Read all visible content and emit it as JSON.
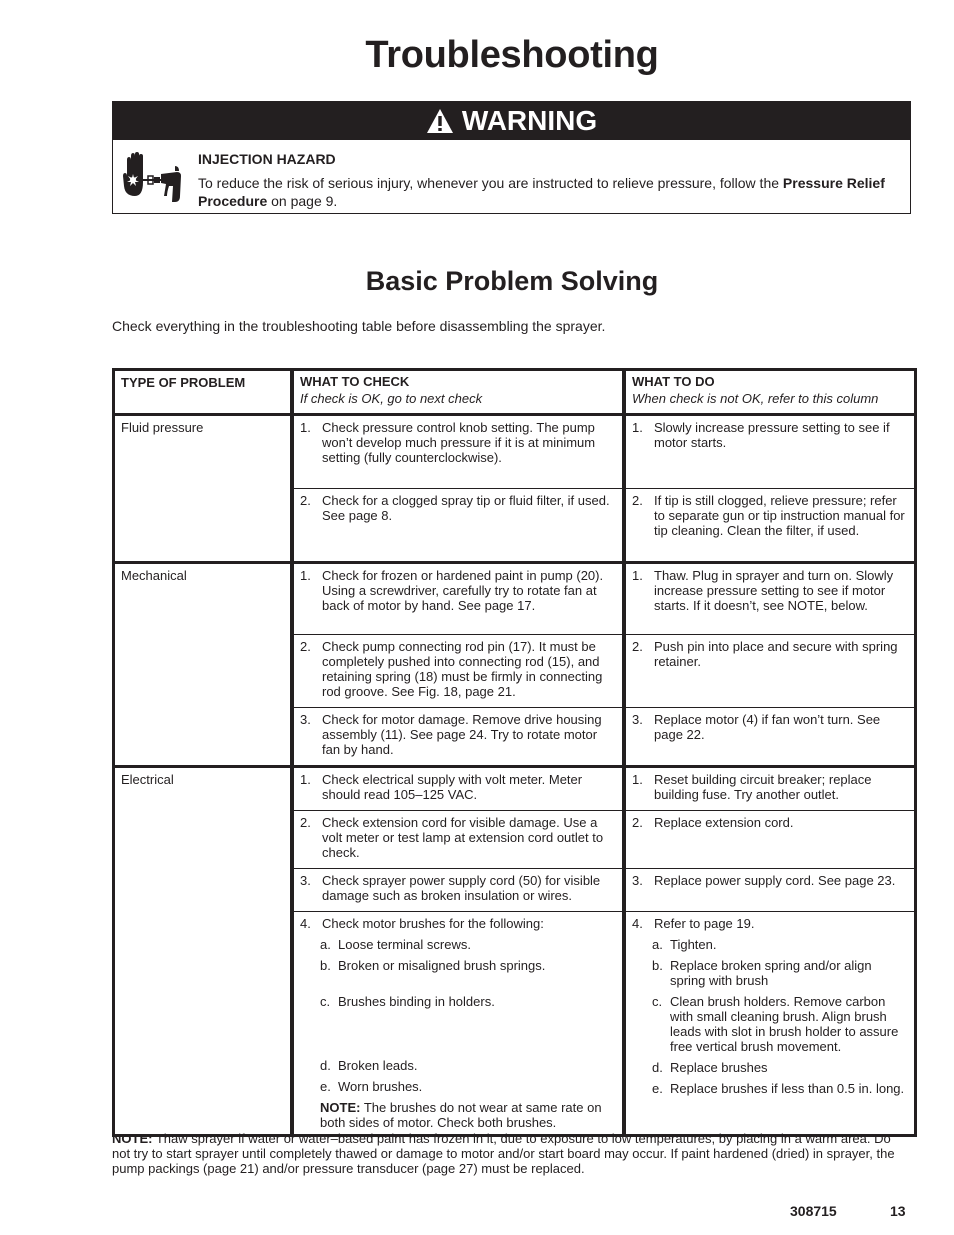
{
  "page": {
    "title": "Troubleshooting",
    "doc_number": "308715",
    "page_number": "13"
  },
  "warning": {
    "header_icon": "warning-triangle-icon",
    "header_label": "WARNING",
    "hazard_icon": "injection-hazard-icon",
    "hazard_title": "INJECTION HAZARD",
    "text_before": "To reduce the risk of serious injury, whenever you are instructed to relieve pressure, follow the ",
    "text_bold": "Pressure Relief Procedure",
    "text_after": " on page 9."
  },
  "section": {
    "title": "Basic Problem Solving",
    "intro": "Check everything in the troubleshooting table before disassembling the sprayer."
  },
  "table": {
    "headers": {
      "type": "TYPE OF PROBLEM",
      "check": "WHAT TO CHECK",
      "check_sub": "If check is OK, go to next check",
      "do": "WHAT TO DO",
      "do_sub": "When check is not OK, refer to this column"
    },
    "groups": [
      {
        "type": "Fluid pressure",
        "rows": [
          {
            "num": "1.",
            "check": "Check pressure control knob setting. The pump won’t develop much pressure if it is at minimum setting (fully counterclockwise).",
            "do": "Slowly increase pressure setting to see if motor starts."
          },
          {
            "num": "2.",
            "check": "Check for a clogged spray tip or fluid filter, if used. See page 8.",
            "do": "If tip is still clogged, relieve pressure; refer to separate gun or tip instruction manual for tip cleaning. Clean the filter, if used."
          }
        ]
      },
      {
        "type": "Mechanical",
        "rows": [
          {
            "num": "1.",
            "check": "Check for frozen or hardened paint in pump (20). Using a screwdriver, carefully try to rotate fan at back of motor by hand. See page 17.",
            "do": "Thaw. Plug in sprayer and turn on. Slowly increase pressure setting to see if motor starts. If it doesn’t, see NOTE, below."
          },
          {
            "num": "2.",
            "check": "Check pump connecting rod pin (17). It must be completely pushed into connecting rod (15), and retaining spring (18) must be firmly in connecting rod groove. See Fig. 18, page 21.",
            "do": "Push pin into place and secure with spring retainer."
          },
          {
            "num": "3.",
            "check": "Check for motor damage. Remove drive housing assembly (11). See page 24. Try to rotate motor fan by hand.",
            "do": "Replace motor (4) if fan won’t turn. See page 22."
          }
        ]
      },
      {
        "type": "Electrical",
        "rows": [
          {
            "num": "1.",
            "check": "Check electrical supply with volt meter. Meter should read 105–125 VAC.",
            "do": "Reset building circuit breaker; replace building fuse. Try another outlet."
          },
          {
            "num": "2.",
            "check": "Check extension cord for visible damage. Use a volt meter or test lamp at extension cord outlet to check.",
            "do": "Replace extension cord."
          },
          {
            "num": "3.",
            "check": "Check sprayer power supply cord (50) for visible damage such as broken insulation or wires.",
            "do": "Replace power supply cord. See page 23."
          },
          {
            "num": "4.",
            "check": "Check motor brushes for the following:",
            "do": "Refer to page 19.",
            "subitems": [
              {
                "letter": "a.",
                "check": "Loose terminal screws.",
                "do": "Tighten."
              },
              {
                "letter": "b.",
                "check": "Broken or misaligned brush springs.",
                "do": "Replace broken spring and/or align spring with brush"
              },
              {
                "letter": "c.",
                "check": "Brushes binding in holders.",
                "do": "Clean brush holders. Remove carbon with small cleaning brush. Align brush leads with slot in brush holder to assure free vertical brush movement."
              },
              {
                "letter": "d.",
                "check": "Broken leads.",
                "do": "Replace brushes"
              },
              {
                "letter": "e.",
                "check": "Worn brushes.",
                "do": "Replace brushes if less than 0.5 in. long."
              }
            ],
            "check_note_label": "NOTE:",
            "check_note": " The brushes do not wear at same rate on both sides of motor. Check both brushes."
          }
        ]
      }
    ]
  },
  "footer_note": {
    "label": "NOTE:",
    "text": " Thaw sprayer if water or water–based paint has frozen in it, due to exposure to low temperatures, by placing in a warm area. Do not try to start sprayer until completely thawed or damage to motor and/or start board may occur. If paint hardened (dried) in sprayer, the pump packings (page 21) and/or pressure transducer (page 27) must be replaced."
  }
}
